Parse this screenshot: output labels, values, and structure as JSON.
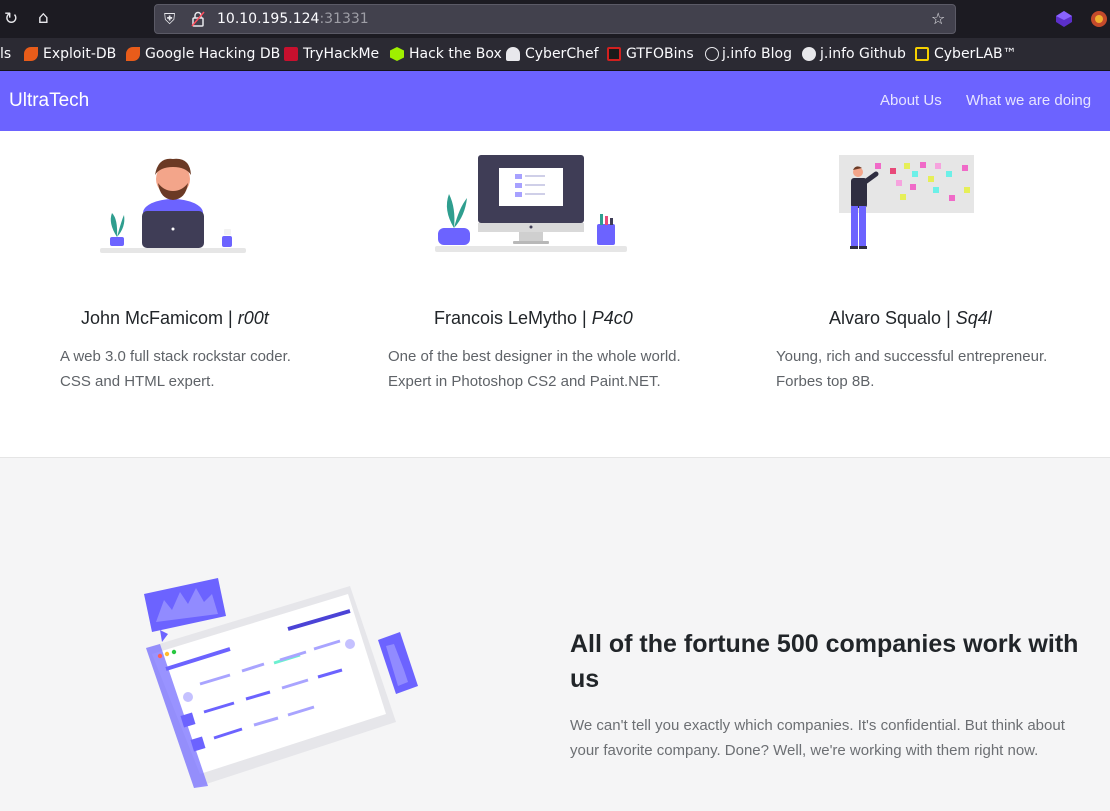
{
  "browser": {
    "url_host": "10.10.195.124",
    "url_port": ":31331",
    "bookmarks": [
      {
        "label": "ls"
      },
      {
        "label": "Exploit-DB"
      },
      {
        "label": "Google Hacking DB"
      },
      {
        "label": "TryHackMe"
      },
      {
        "label": "Hack the Box"
      },
      {
        "label": "CyberChef"
      },
      {
        "label": "GTFOBins"
      },
      {
        "label": "j.info Blog"
      },
      {
        "label": "j.info Github"
      },
      {
        "label": "CyberLAB™"
      }
    ]
  },
  "navbar": {
    "brand": "UltraTech",
    "links": [
      "About Us",
      "What we are doing"
    ],
    "color": "#6c63ff"
  },
  "team": [
    {
      "name": "John McFamicom | ",
      "handle": "r00t",
      "desc_lines": [
        "A web 3.0 full stack rockstar coder.",
        "CSS and HTML expert."
      ]
    },
    {
      "name": "Francois LeMytho | ",
      "handle": "P4c0",
      "desc_lines": [
        "One of the best designer in the whole world.",
        "Expert in Photoshop CS2 and Paint.NET."
      ]
    },
    {
      "name": "Alvaro Squalo | ",
      "handle": "Sq4l",
      "desc_lines": [
        "Young, rich and successful entrepreneur.",
        "Forbes top 8B."
      ]
    }
  ],
  "companies": {
    "title": "All of the fortune 500 companies work with us",
    "text": "We can't tell you exactly which companies. It's confidential. But think about your favorite company. Done? Well, we're working with them right now."
  }
}
